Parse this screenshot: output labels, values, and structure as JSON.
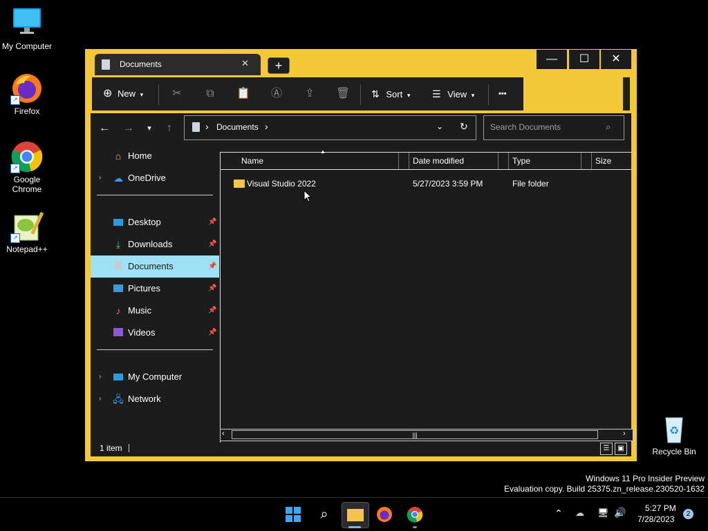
{
  "desktop": {
    "icons": [
      {
        "label": "My Computer"
      },
      {
        "label": "Firefox"
      },
      {
        "label": "Google Chrome"
      },
      {
        "label": "Notepad++"
      }
    ],
    "recycle_bin": "Recycle Bin",
    "watermark_line1": "Windows 11 Pro Insider Preview",
    "watermark_line2": "Evaluation copy. Build 25375.zn_release.230520-1632"
  },
  "explorer": {
    "tab_title": "Documents",
    "new_tab_glyph": "+",
    "window_controls": {
      "minimize": "—",
      "maximize": "☐",
      "close": "✕"
    },
    "toolbar": {
      "new_label": "New",
      "sort_label": "Sort",
      "view_label": "View",
      "more_label": "•••"
    },
    "address": {
      "segment": "Documents",
      "separator": "›"
    },
    "search_placeholder": "Search Documents",
    "nav": {
      "home": "Home",
      "onedrive": "OneDrive",
      "desktop": "Desktop",
      "downloads": "Downloads",
      "documents": "Documents",
      "pictures": "Pictures",
      "music": "Music",
      "videos": "Videos",
      "my_computer": "My Computer",
      "network": "Network"
    },
    "columns": {
      "name": "Name",
      "date": "Date modified",
      "type": "Type",
      "size": "Size"
    },
    "files": [
      {
        "name": "Visual Studio 2022",
        "date": "5/27/2023 3:59 PM",
        "type": "File folder",
        "size": ""
      }
    ],
    "status_count": "1 item"
  },
  "taskbar": {
    "time": "5:27 PM",
    "date": "7/28/2023",
    "notification_count": "2"
  },
  "colors": {
    "window_frame": "#f5c73a",
    "selection": "#9ee0f4",
    "background": "#000000"
  }
}
